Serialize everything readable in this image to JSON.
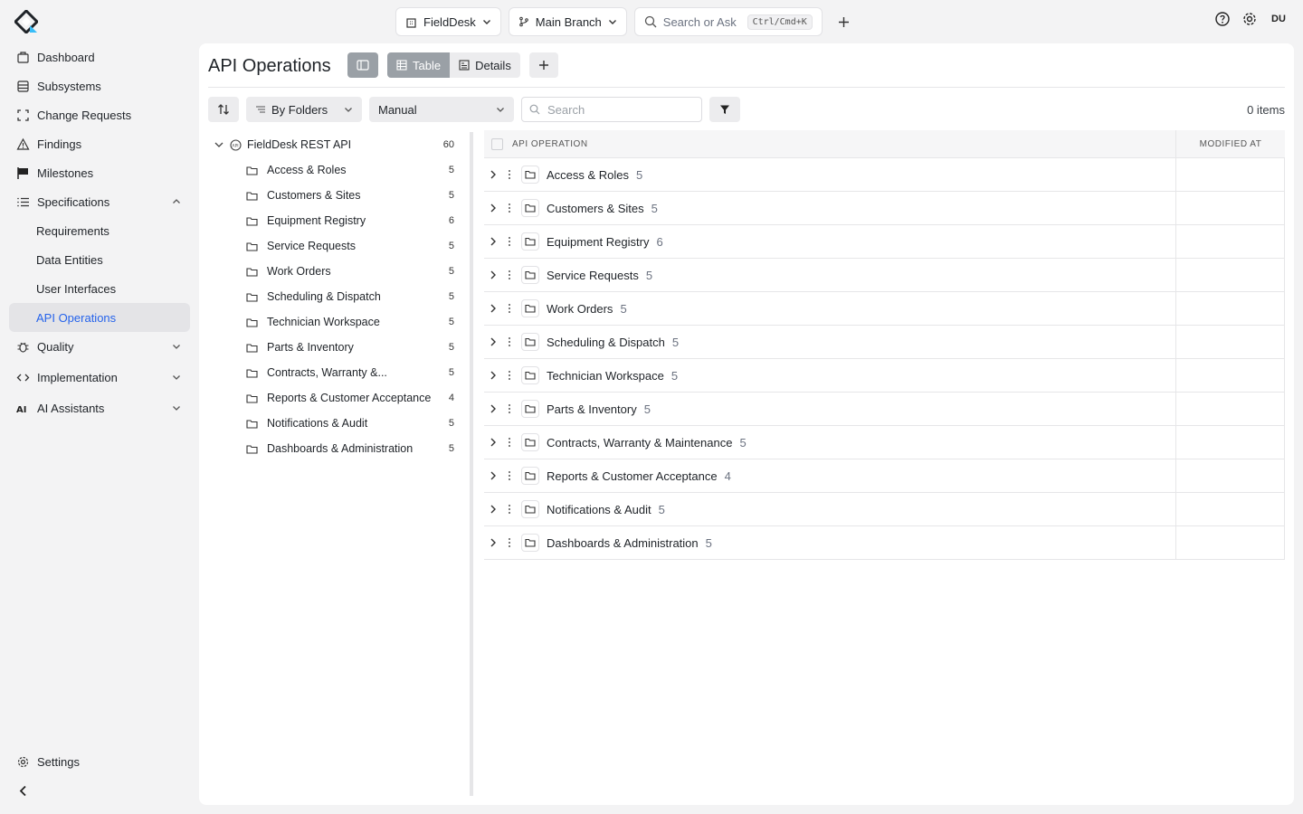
{
  "topbar": {
    "project": "FieldDesk",
    "branch": "Main Branch",
    "search_placeholder": "Search or Ask",
    "search_shortcut": "Ctrl/Cmd+K",
    "avatar": "DU"
  },
  "sidebar": {
    "items": [
      {
        "label": "Dashboard",
        "icon": "dashboard-icon"
      },
      {
        "label": "Subsystems",
        "icon": "subsystems-icon"
      },
      {
        "label": "Change Requests",
        "icon": "change-requests-icon"
      },
      {
        "label": "Findings",
        "icon": "warning-icon"
      },
      {
        "label": "Milestones",
        "icon": "flag-icon"
      },
      {
        "label": "Specifications",
        "icon": "list-icon",
        "expanded": true
      },
      {
        "label": "Requirements"
      },
      {
        "label": "Data Entities"
      },
      {
        "label": "User Interfaces"
      },
      {
        "label": "API Operations",
        "active": true
      },
      {
        "label": "Quality",
        "icon": "bug-icon"
      },
      {
        "label": "Implementation",
        "icon": "code-icon"
      },
      {
        "label": "AI Assistants",
        "icon": "ai-icon"
      }
    ],
    "settings": "Settings"
  },
  "page": {
    "title": "API Operations",
    "view_table": "Table",
    "view_details": "Details",
    "group_by": "By Folders",
    "sort_mode": "Manual",
    "search_placeholder": "Search",
    "items_count": "0 items"
  },
  "tree": {
    "root": {
      "label": "FieldDesk REST API",
      "count": "60"
    },
    "children": [
      {
        "label": "Access & Roles",
        "count": "5"
      },
      {
        "label": "Customers & Sites",
        "count": "5"
      },
      {
        "label": "Equipment Registry",
        "count": "6"
      },
      {
        "label": "Service Requests",
        "count": "5"
      },
      {
        "label": "Work Orders",
        "count": "5"
      },
      {
        "label": "Scheduling & Dispatch",
        "count": "5"
      },
      {
        "label": "Technician Workspace",
        "count": "5"
      },
      {
        "label": "Parts & Inventory",
        "count": "5"
      },
      {
        "label": "Contracts, Warranty &...",
        "count": "5"
      },
      {
        "label": "Reports & Customer Acceptance",
        "count": "4"
      },
      {
        "label": "Notifications & Audit",
        "count": "5"
      },
      {
        "label": "Dashboards & Administration",
        "count": "5"
      }
    ]
  },
  "table": {
    "columns": [
      "API OPERATION",
      "MODIFIED AT"
    ],
    "rows": [
      {
        "name": "Access & Roles",
        "count": "5"
      },
      {
        "name": "Customers & Sites",
        "count": "5"
      },
      {
        "name": "Equipment Registry",
        "count": "6"
      },
      {
        "name": "Service Requests",
        "count": "5"
      },
      {
        "name": "Work Orders",
        "count": "5"
      },
      {
        "name": "Scheduling & Dispatch",
        "count": "5"
      },
      {
        "name": "Technician Workspace",
        "count": "5"
      },
      {
        "name": "Parts & Inventory",
        "count": "5"
      },
      {
        "name": "Contracts, Warranty & Maintenance",
        "count": "5"
      },
      {
        "name": "Reports & Customer Acceptance",
        "count": "4"
      },
      {
        "name": "Notifications & Audit",
        "count": "5"
      },
      {
        "name": "Dashboards & Administration",
        "count": "5"
      }
    ]
  },
  "colors": {
    "accent": "#2563eb",
    "active_bg": "#e4e4e7",
    "toggle_on": "#9aa0a6"
  }
}
